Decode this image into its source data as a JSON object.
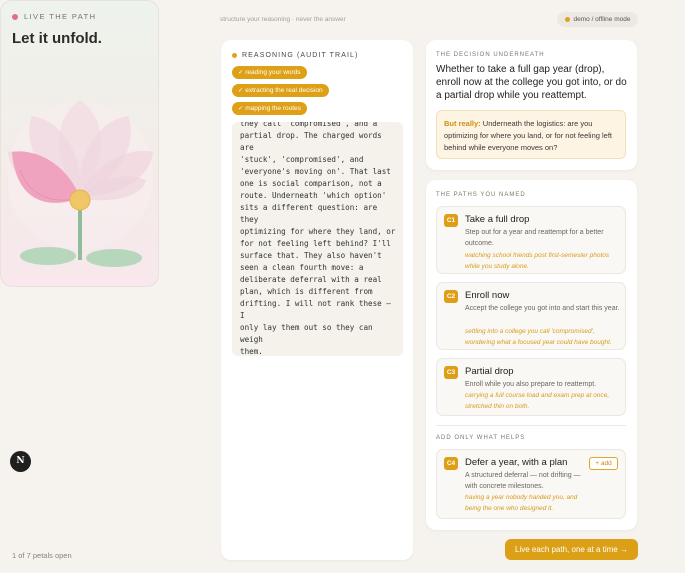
{
  "petal_card": {
    "brand": "LIVE THE PATH",
    "headline": "Let it unfold.",
    "petals_status": "1 of 7 petals open",
    "petals_open": 1,
    "petals_total": 7
  },
  "header": {
    "tagline": "structure your reasoning · never the answer",
    "mode": "demo / offline mode"
  },
  "reasoning": {
    "title": "REASONING (AUDIT TRAIL)",
    "steps": [
      "✓ reading your words",
      "✓ extracting the real decision",
      "✓ mapping the routes"
    ],
    "trace": "they call 'compromised', and a\npartial drop. The charged words are\n'stuck', 'compromised', and\n'everyone's moving on'. That last\none is social comparison, not a\nroute. Underneath 'which option'\nsits a different question: are they\noptimizing for where they land, or\nfor not feeling left behind? I'll\nsurface that. They also haven't\nseen a clean fourth move: a\ndeliberate deferral with a real\nplan, which is different from\ndrifting. I will not rank these — I\nonly lay them out so they can weigh\nthem."
  },
  "decision": {
    "label": "THE DECISION UNDERNEATH",
    "question": "Whether to take a full gap year (drop), enroll now at the college you got into, or do a partial drop while you reattempt.",
    "reality_lead": "But really:",
    "reality_text": " Underneath the logistics: are you optimizing for where you land, or for not feeling left behind while everyone moves on?"
  },
  "paths": {
    "label": "THE PATHS YOU NAMED",
    "items": [
      {
        "code": "C1",
        "title": "Take a full drop",
        "desc": "Step out for a year and reattempt for a better outcome.",
        "note": "watching school friends post first-semester photos while you study alone."
      },
      {
        "code": "C2",
        "title": "Enroll now",
        "desc": "Accept the college you got into and start this year.",
        "note": "settling into a college you call 'compromised', wondering what a focused year could have bought."
      },
      {
        "code": "C3",
        "title": "Partial drop",
        "desc": "Enroll while you also prepare to reattempt.",
        "note": "carrying a full course load and exam prep at once, stretched thin on both."
      }
    ],
    "add_label": "ADD ONLY WHAT HELPS",
    "suggestion": {
      "code": "C4",
      "title": "Defer a year, with a plan",
      "desc": "A structured deferral — not drifting — with concrete milestones.",
      "note": "having a year nobody handed you, and being the one who designed it.",
      "add_button": "+ add"
    }
  },
  "cta": "Live each path, one at a time →",
  "next_badge": "N"
}
